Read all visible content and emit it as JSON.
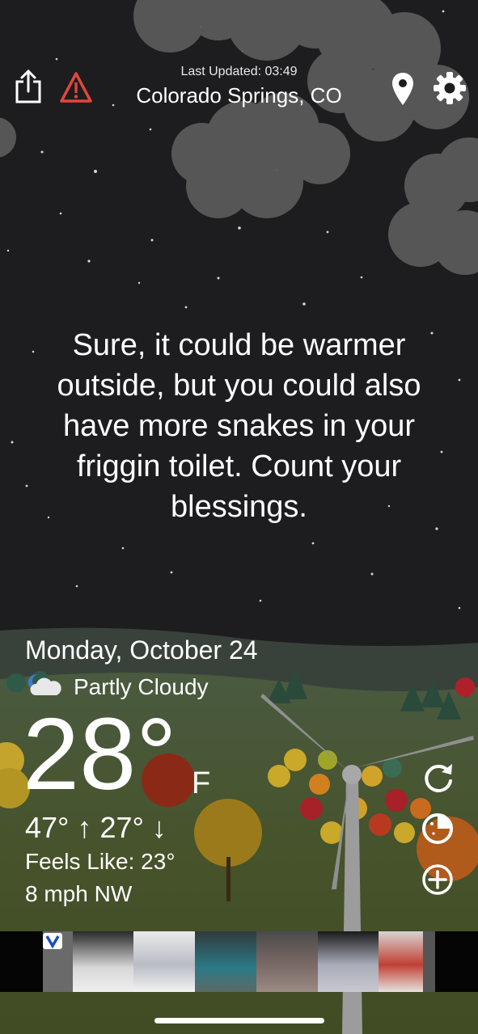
{
  "header": {
    "last_updated": "Last Updated: 03:49",
    "location": "Colorado Springs, CO",
    "share_icon": "share-icon",
    "alert_icon": "warning-icon",
    "location_icon": "map-pin-icon",
    "settings_icon": "gear-icon"
  },
  "quote": "Sure, it could be warmer outside, but you could also have more snakes in your friggin toilet. Count your blessings.",
  "weather": {
    "date": "Monday, October 24",
    "condition": "Partly Cloudy",
    "condition_icon": "partly-cloudy-night-icon",
    "temperature": "28°",
    "unit": "F",
    "high_low": "47° ↑  27° ↓",
    "feels_like": "Feels Like: 23°",
    "wind": "8 mph NW"
  },
  "side_buttons": [
    "refresh-icon",
    "radar-icon",
    "add-icon"
  ],
  "ad": {
    "badge_icon": "ad-choices-icon",
    "items": 6
  },
  "colors": {
    "sky": "#1d1d1f",
    "ground": "#49562c",
    "alert": "#e0463c"
  }
}
